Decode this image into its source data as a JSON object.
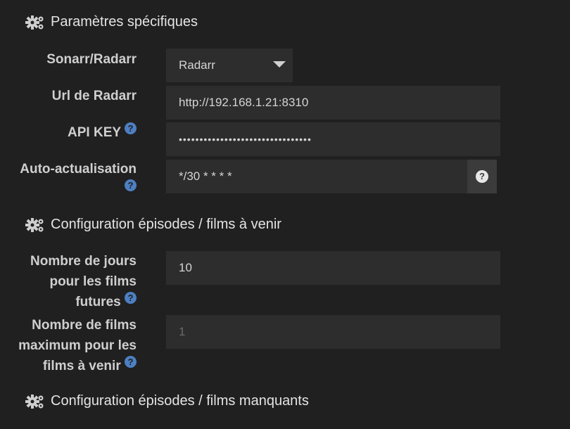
{
  "sections": {
    "specific": "Paramètres spécifiques",
    "upcoming": "Configuration épisodes / films à venir",
    "missing": "Configuration épisodes / films manquants"
  },
  "fields": {
    "sonarr_radarr": {
      "label": "Sonarr/Radarr",
      "value": "Radarr"
    },
    "url": {
      "label": "Url de Radarr",
      "value": "http://192.168.1.21:8310"
    },
    "api_key": {
      "label": "API KEY",
      "value": "••••••••••••••••••••••••••••••••"
    },
    "auto_refresh": {
      "label": "Auto-actualisation",
      "value": "*/30 * * * *"
    },
    "days_future": {
      "label_line1": "Nombre de jours",
      "label_line2": "pour les films",
      "label_line3": "futures",
      "value": "10"
    },
    "max_films": {
      "label_line1": "Nombre de films",
      "label_line2": "maximum pour les",
      "label_line3": "films à venir",
      "value": "1"
    }
  },
  "help_glyph": "?",
  "icons": [
    "cogs-icon",
    "help-icon",
    "caret-down-icon"
  ]
}
